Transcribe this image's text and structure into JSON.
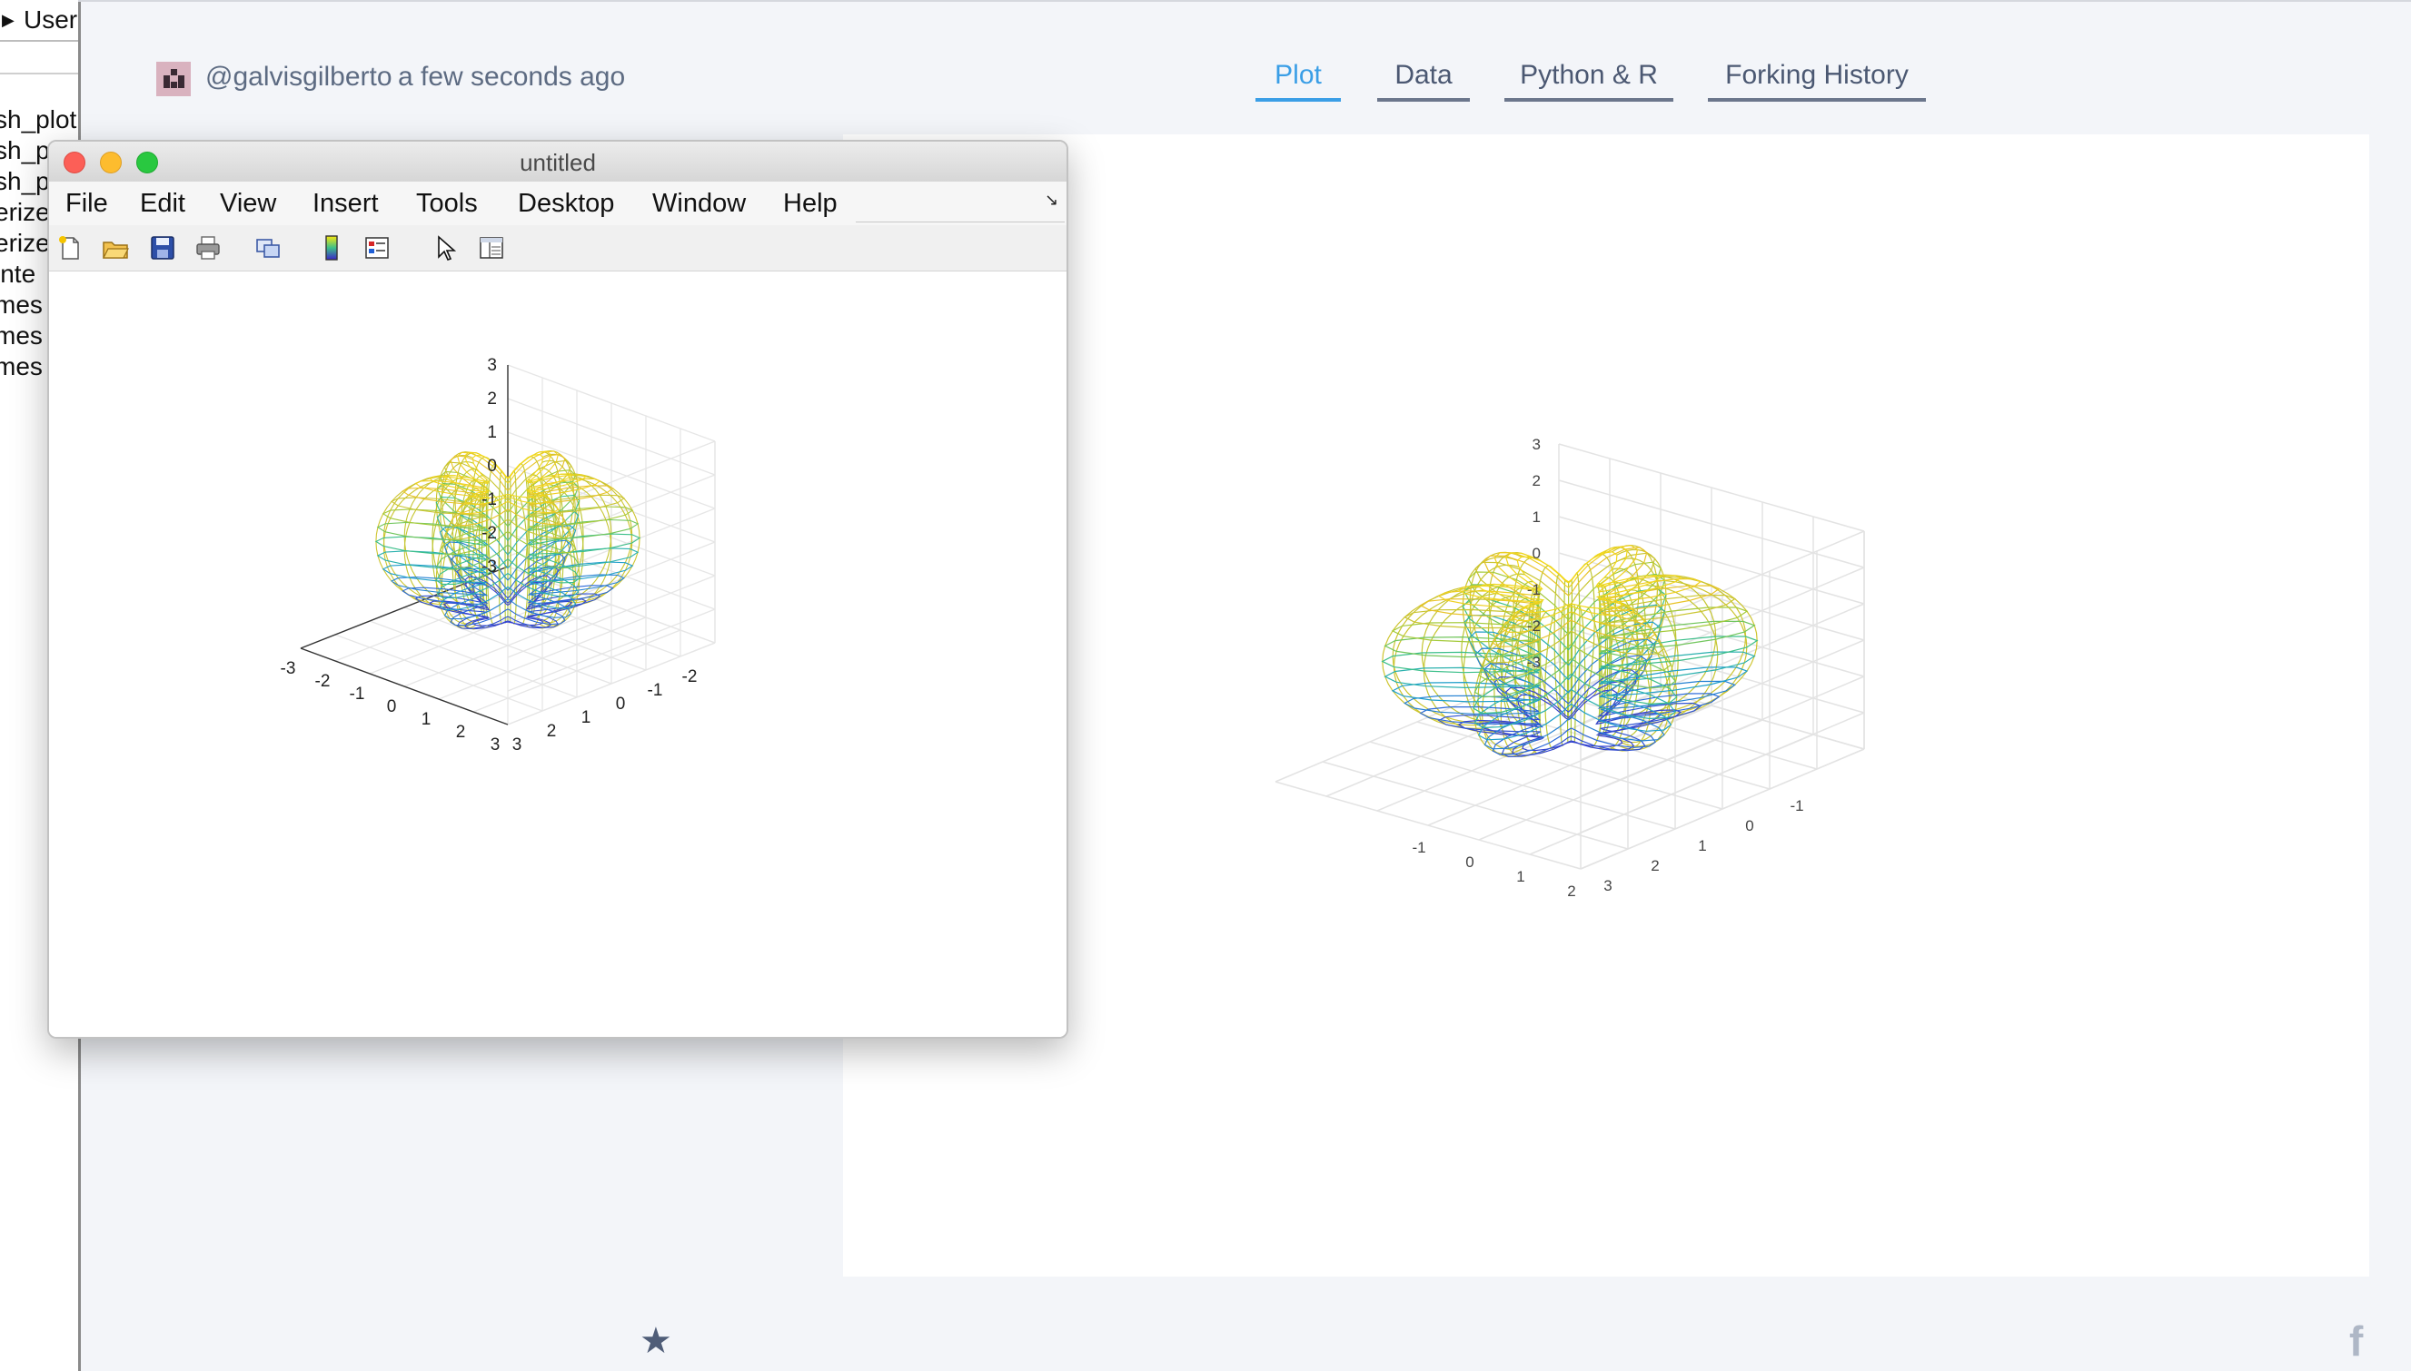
{
  "sidebar": {
    "header_label": "Users",
    "files": [
      "sh_plot",
      "sh_p",
      "sh_p",
      "erize",
      "erize",
      "inte",
      "mes",
      "mes",
      "mes"
    ]
  },
  "post": {
    "username": "@galvisgilberto",
    "timestamp": "a few seconds ago"
  },
  "tabs": [
    {
      "label": "Plot",
      "active": true
    },
    {
      "label": "Data",
      "active": false
    },
    {
      "label": "Python & R",
      "active": false
    },
    {
      "label": "Forking History",
      "active": false
    }
  ],
  "figure_window": {
    "title": "untitled",
    "menu": [
      "File",
      "Edit",
      "View",
      "Insert",
      "Tools",
      "Desktop",
      "Window",
      "Help"
    ],
    "toolbar_icons": [
      "new-figure-icon",
      "open-file-icon",
      "save-icon",
      "print-icon",
      "link-plot-icon",
      "colorbar-icon",
      "legend-icon",
      "pointer-icon",
      "property-inspector-icon"
    ],
    "axes": {
      "z_ticks": [
        "3",
        "2",
        "1",
        "0",
        "-1",
        "-2",
        "-3"
      ],
      "y_ticks": [
        "3",
        "2",
        "1",
        "0",
        "-1",
        "-2",
        "-3"
      ],
      "x_ticks": [
        "-2",
        "-1",
        "0",
        "1",
        "2",
        "3"
      ]
    }
  },
  "plotly_chart": {
    "axes": {
      "z_ticks": [
        "3",
        "2",
        "1",
        "0",
        "-1",
        "-2",
        "-3"
      ],
      "y_ticks": [
        "2",
        "1",
        "0",
        "-1"
      ],
      "x_ticks": [
        "3",
        "2",
        "1",
        "0",
        "-1"
      ]
    }
  },
  "footer": {
    "star_icon": "star-icon",
    "social_icon": "facebook-icon",
    "facebook_glyph": "f"
  },
  "colors": {
    "accent": "#3a9ee6",
    "tab_text": "#4b5872",
    "background": "#f3f5f9",
    "surface_colormap": [
      "#3b23c8",
      "#2a6bd8",
      "#1fa6c8",
      "#3cbf8a",
      "#9acb3c",
      "#e8c22a",
      "#f9e80f"
    ]
  }
}
